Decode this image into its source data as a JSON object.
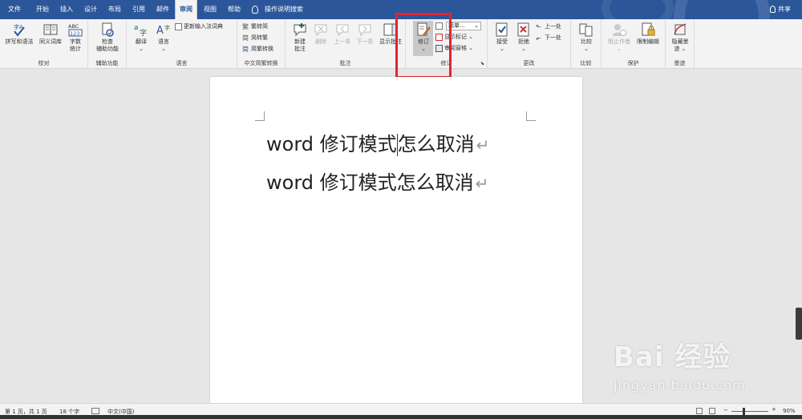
{
  "tabs": [
    "文件",
    "开始",
    "插入",
    "设计",
    "布局",
    "引用",
    "邮件",
    "审阅",
    "视图",
    "帮助"
  ],
  "active_tab_index": 7,
  "tell_me": "操作说明搜索",
  "share": "共享",
  "ribbon": {
    "proofing": {
      "label": "校对",
      "spelling": "拼写和语法",
      "thesaurus": "同义词库",
      "word_count_line1": "字数",
      "word_count_line2": "统计"
    },
    "accessibility": {
      "label": "辅助功能",
      "check_line1": "检查",
      "check_line2": "辅助功能"
    },
    "language": {
      "label": "语言",
      "translate": "翻译",
      "language_btn": "语言",
      "update_ime": "更新输入法词典"
    },
    "chinese_conversion": {
      "label": "中文简繁转换",
      "to_simplified": "繁转简",
      "to_traditional": "简转繁",
      "convert": "简繁转换"
    },
    "comments": {
      "label": "批注",
      "new_line1": "新建",
      "new_line2": "批注",
      "delete": "删除",
      "previous": "上一条",
      "next": "下一条",
      "show": "显示批注"
    },
    "tracking": {
      "label": "修订",
      "track_changes": "修订",
      "markup_select": "简单...",
      "show_markup": "显示标记",
      "reviewing_pane": "审阅窗格"
    },
    "changes": {
      "label": "更改",
      "accept": "接受",
      "reject": "拒绝",
      "previous": "上一处",
      "next": "下一处"
    },
    "compare": {
      "label": "比较",
      "compare": "比较"
    },
    "protect": {
      "label": "保护",
      "block_authors": "阻止作者",
      "restrict_editing": "限制编辑"
    },
    "ink": {
      "label": "墨迹",
      "hide_ink_line1": "隐藏墨",
      "hide_ink_line2": "迹"
    }
  },
  "document": {
    "line1_before": "word 修订模式",
    "line1_after": "怎么取消",
    "line2": "word 修订模式怎么取消",
    "paragraph_mark": "↵"
  },
  "status": {
    "page": "第 1 页，共 1 页",
    "words": "18 个字",
    "language": "中文(中国)",
    "zoom": "90%"
  },
  "watermark": {
    "brand": "Bai 经验",
    "url": "jingyan.baidu.com"
  },
  "colors": {
    "title_bar": "#2b579a",
    "highlight_box": "#e0262c"
  }
}
